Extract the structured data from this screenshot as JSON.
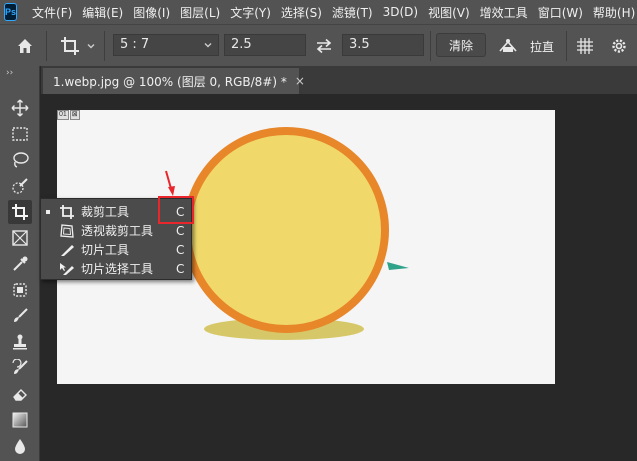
{
  "app": {
    "logo": "Ps"
  },
  "menu": [
    "文件(F)",
    "编辑(E)",
    "图像(I)",
    "图层(L)",
    "文字(Y)",
    "选择(S)",
    "滤镜(T)",
    "3D(D)",
    "视图(V)",
    "增效工具",
    "窗口(W)",
    "帮助(H)"
  ],
  "options": {
    "ratio_value": "5 : 7",
    "width_value": "2.5",
    "height_value": "3.5",
    "clear_label": "清除",
    "straighten_label": "拉直"
  },
  "tab": {
    "title": "1.webp.jpg @ 100% (图层 0, RGB/8#) *",
    "close": "×"
  },
  "canvas": {
    "layer_tag_a": "01",
    "layer_tag_b": "⊠"
  },
  "flyout": {
    "items": [
      {
        "label": "裁剪工具",
        "shortcut": "C",
        "icon": "crop-icon",
        "active": true
      },
      {
        "label": "透视裁剪工具",
        "shortcut": "C",
        "icon": "perspective-crop-icon",
        "active": false
      },
      {
        "label": "切片工具",
        "shortcut": "C",
        "icon": "slice-icon",
        "active": false
      },
      {
        "label": "切片选择工具",
        "shortcut": "C",
        "icon": "slice-select-icon",
        "active": false
      }
    ]
  },
  "colors": {
    "highlight": "#e8262c",
    "ball_fill": "#f0d96a",
    "ball_ring": "#e8862a",
    "shadow": "#d6c868",
    "leaf": "#2fa28a"
  }
}
